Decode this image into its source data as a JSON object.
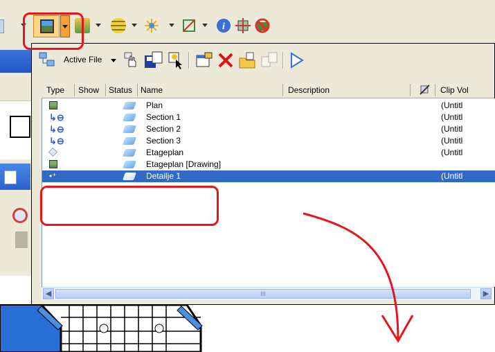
{
  "toolbar": {
    "icons": [
      "view-icon",
      "layers-icon",
      "stack-icon",
      "light-icon",
      "render-icon",
      "info-icon",
      "crosshair-icon",
      "no-display-icon"
    ]
  },
  "dialog": {
    "active_file_label": "Active File",
    "columns": [
      "Type",
      "Show",
      "Status",
      "Name",
      "Description",
      "Clip Vol"
    ],
    "rows": [
      {
        "type_icon": "view-icon",
        "name": "Plan",
        "clip": "(Untitl",
        "selected": false
      },
      {
        "type_icon": "section-icon",
        "name": "Section 1",
        "clip": "(Untitl",
        "selected": false
      },
      {
        "type_icon": "section-icon",
        "name": "Section 2",
        "clip": "(Untitl",
        "selected": false
      },
      {
        "type_icon": "section-icon",
        "name": "Section 3",
        "clip": "(Untitl",
        "selected": false
      },
      {
        "type_icon": "cube-icon",
        "name": "Etageplan",
        "clip": "(Untitl",
        "selected": false
      },
      {
        "type_icon": "view-icon",
        "name": "Etageplan [Drawing]",
        "clip": "",
        "selected": false
      },
      {
        "type_icon": "detail-icon",
        "name": "Detailje 1",
        "clip": "(Untitl",
        "selected": true
      }
    ],
    "scroll_thumb_text": "III"
  },
  "colors": {
    "selection": "#316ac5",
    "annotation": "#e8141a",
    "xp_face": "#ece9d8"
  }
}
